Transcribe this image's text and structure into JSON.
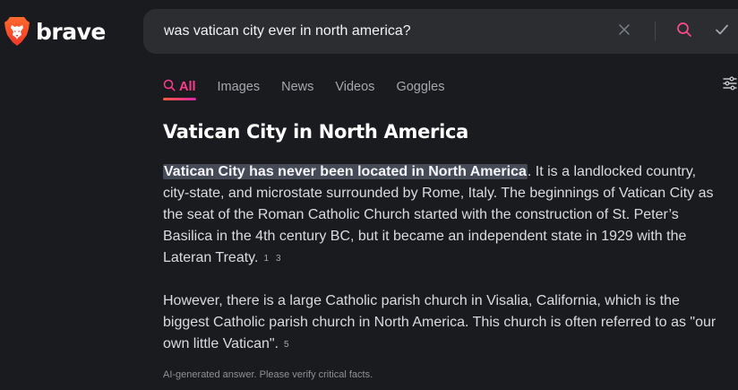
{
  "brand": {
    "name": "brave",
    "accent": "#fb542b"
  },
  "search": {
    "query": "was vatican city ever in north america?",
    "clear_icon": "close-icon",
    "search_icon": "search-icon",
    "submit_icon": "check-icon"
  },
  "tabs": [
    {
      "label": "All",
      "icon": "search-icon",
      "active": true
    },
    {
      "label": "Images",
      "active": false
    },
    {
      "label": "News",
      "active": false
    },
    {
      "label": "Videos",
      "active": false
    },
    {
      "label": "Goggles",
      "active": false
    }
  ],
  "settings_icon": "sliders-icon",
  "answer": {
    "title": "Vatican City in North America",
    "paragraph1": {
      "highlight": "Vatican City has never been located in North America",
      "text": ". It is a landlocked country, city-state, and microstate surrounded by Rome, Italy. The beginnings of Vatican City as the seat of the Roman Catholic Church started with the construction of St. Peter’s Basilica in the 4th century BC, but it became an independent state in 1929 with the Lateran Treaty.",
      "citations": [
        "1",
        "3"
      ]
    },
    "paragraph2": {
      "text": "However, there is a large Catholic parish church in Visalia, California, which is the biggest Catholic parish church in North America. This church is often referred to as \"our own little Vatican\".",
      "citations": [
        "5"
      ]
    },
    "disclaimer": "AI-generated answer. Please verify critical facts."
  },
  "colors": {
    "background": "#1a1b1e",
    "search_bg": "#2b2d31",
    "tab_active": "#ff3c8c",
    "highlight_bg": "#464a57"
  }
}
